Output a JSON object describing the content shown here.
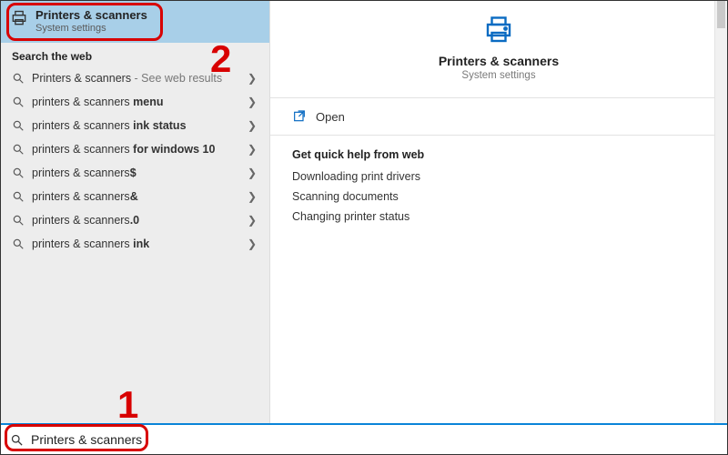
{
  "best_match": {
    "title": "Printers & scanners",
    "subtitle": "System settings"
  },
  "web_section_label": "Search the web",
  "suggestions": [
    {
      "prefix": "Printers & scanners",
      "bold": "",
      "hint": " - See web results"
    },
    {
      "prefix": "printers & scanners ",
      "bold": "menu",
      "hint": ""
    },
    {
      "prefix": "printers & scanners ",
      "bold": "ink status",
      "hint": ""
    },
    {
      "prefix": "printers & scanners ",
      "bold": "for windows 10",
      "hint": ""
    },
    {
      "prefix": "printers & scanners",
      "bold": "$",
      "hint": ""
    },
    {
      "prefix": "printers & scanners",
      "bold": "&",
      "hint": ""
    },
    {
      "prefix": "printers & scanners",
      "bold": ".0",
      "hint": ""
    },
    {
      "prefix": "printers & scanners ",
      "bold": "ink",
      "hint": ""
    }
  ],
  "detail": {
    "title": "Printers & scanners",
    "subtitle": "System settings",
    "open_label": "Open",
    "quick_help_title": "Get quick help from web",
    "quick_links": [
      "Downloading print drivers",
      "Scanning documents",
      "Changing printer status"
    ]
  },
  "search_text": "Printers & scanners",
  "annotations": {
    "one": "1",
    "two": "2"
  }
}
